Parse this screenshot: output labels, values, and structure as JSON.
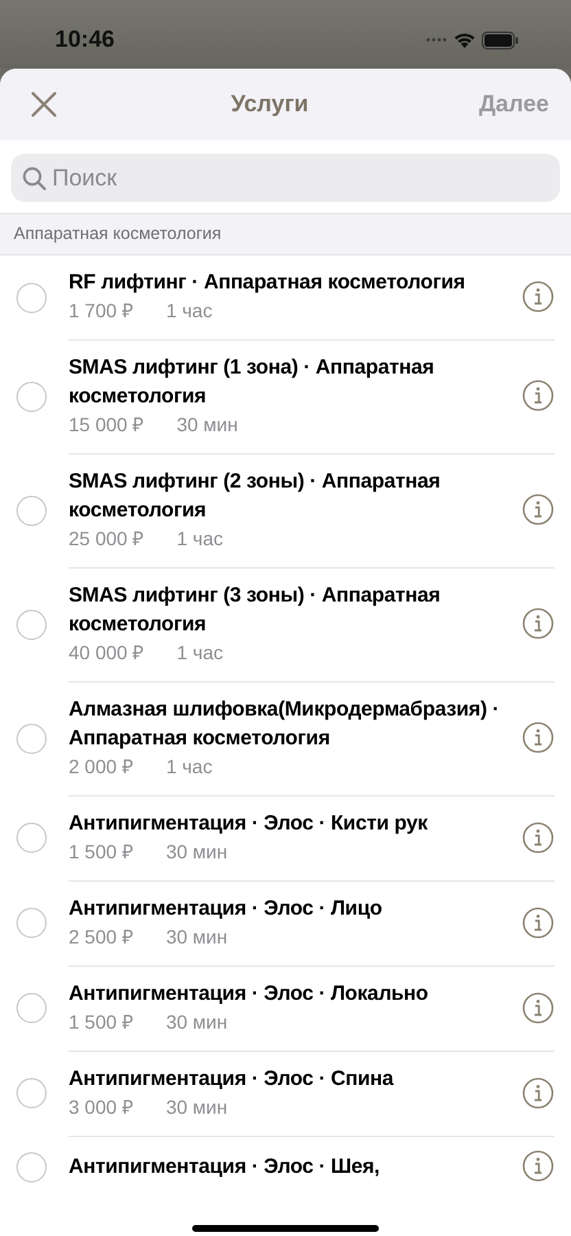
{
  "status_bar": {
    "time": "10:46"
  },
  "header": {
    "title": "Услуги",
    "next_button": {
      "label": "Далее",
      "disabled": true
    }
  },
  "search": {
    "placeholder": "Поиск"
  },
  "section": {
    "title": "Аппаратная косметология",
    "items": [
      {
        "title": "RF лифтинг · Аппаратная косметология",
        "price": "1 700 ₽",
        "duration": "1 час",
        "selected": false
      },
      {
        "title": "SMAS лифтинг (1 зона) · Аппаратная косметология",
        "price": "15 000 ₽",
        "duration": "30 мин",
        "selected": false
      },
      {
        "title": "SMAS лифтинг (2 зоны) · Аппаратная косметология",
        "price": "25 000 ₽",
        "duration": "1 час",
        "selected": false
      },
      {
        "title": "SMAS лифтинг (3 зоны) · Аппаратная косметология",
        "price": "40 000 ₽",
        "duration": "1 час",
        "selected": false
      },
      {
        "title": "Алмазная шлифовка(Микродермабразия) · Аппаратная косметология",
        "price": "2 000 ₽",
        "duration": "1 час",
        "selected": false
      },
      {
        "title": "Антипигментация · Элос · Кисти рук",
        "price": "1 500 ₽",
        "duration": "30 мин",
        "selected": false
      },
      {
        "title": "Антипигментация · Элос · Лицо",
        "price": "2 500 ₽",
        "duration": "30 мин",
        "selected": false
      },
      {
        "title": "Антипигментация · Элос · Локально",
        "price": "1 500 ₽",
        "duration": "30 мин",
        "selected": false
      },
      {
        "title": "Антипигментация · Элос · Спина",
        "price": "3 000 ₽",
        "duration": "30 мин",
        "selected": false
      },
      {
        "title": "Антипигментация · Элос · Шея,",
        "selected": false
      }
    ]
  }
}
